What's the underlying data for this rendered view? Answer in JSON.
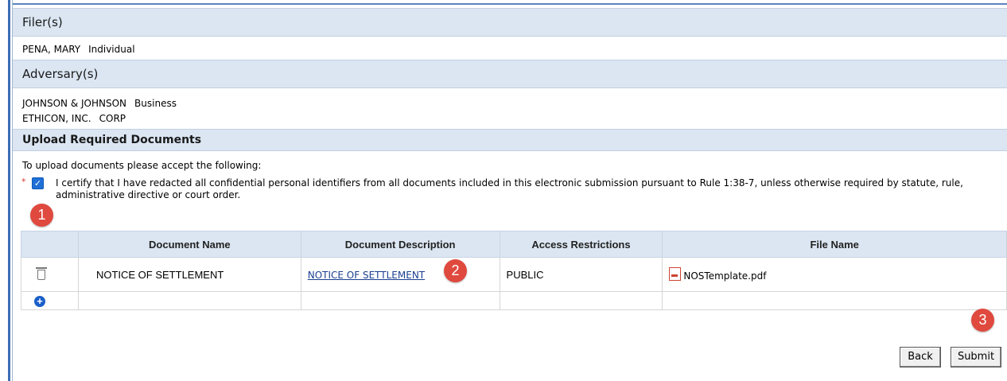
{
  "filers": {
    "heading": "Filer(s)",
    "entries": [
      {
        "name": "PENA, MARY",
        "type": "Individual"
      }
    ]
  },
  "adversaries": {
    "heading": "Adversary(s)",
    "entries": [
      {
        "name": "JOHNSON & JOHNSON",
        "type": "Business"
      },
      {
        "name": "ETHICON, INC.",
        "type": "CORP"
      }
    ]
  },
  "upload": {
    "heading": "Upload Required Documents",
    "intro": "To upload documents please accept the following:",
    "required_marker": "*",
    "certify_checked": true,
    "certify_text": "I certify that I have redacted all confidential personal identifiers from all documents included in this electronic submission pursuant to Rule 1:38-7, unless otherwise required by statute, rule, administrative directive or court order."
  },
  "table": {
    "columns": [
      "",
      "Document Name",
      "Document Description",
      "Access Restrictions",
      "File Name"
    ],
    "rows": [
      {
        "document_name": "NOTICE OF SETTLEMENT",
        "description": "NOTICE OF SETTLEMENT",
        "access": "PUBLIC",
        "file_name": "NOSTemplate.pdf"
      }
    ]
  },
  "badges": [
    "1",
    "2",
    "3"
  ],
  "buttons": {
    "back": "Back",
    "submit": "Submit"
  },
  "colors": {
    "header_bg": "#dbe6f2",
    "badge": "#e0493e",
    "link": "#1b3f91",
    "checkbox": "#1f6fd6"
  }
}
